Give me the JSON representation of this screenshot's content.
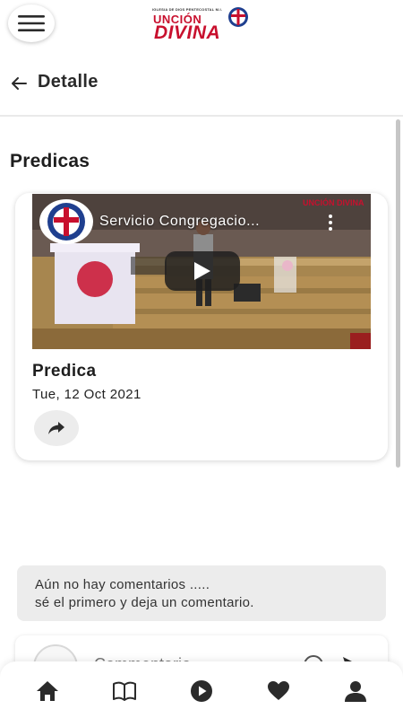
{
  "header": {
    "logo_small": "IGLESIA DE DIOS PENTECOSTAL M.I.",
    "logo_line1": "UNCIÓN",
    "logo_line2": "DIVINA"
  },
  "titlebar": {
    "title": "Detalle"
  },
  "section": {
    "title": "Predicas"
  },
  "post": {
    "video_title": "Servicio Congregacio...",
    "watermark": "UNCIÓN DIVINA",
    "title": "Predica",
    "date": "Tue, 12 Oct 2021"
  },
  "comments": {
    "empty_line1": "Aún no hay comentarios .....",
    "empty_line2": "sé el primero y deja un comentario.",
    "input_placeholder": "Commentario"
  },
  "nav": {
    "items": [
      "home-icon",
      "book-icon",
      "play-icon",
      "heart-icon",
      "profile-icon"
    ]
  },
  "colors": {
    "brand_red": "#c8102e",
    "brand_blue": "#1f3f8f",
    "icon_dark": "#2b2b2b"
  }
}
